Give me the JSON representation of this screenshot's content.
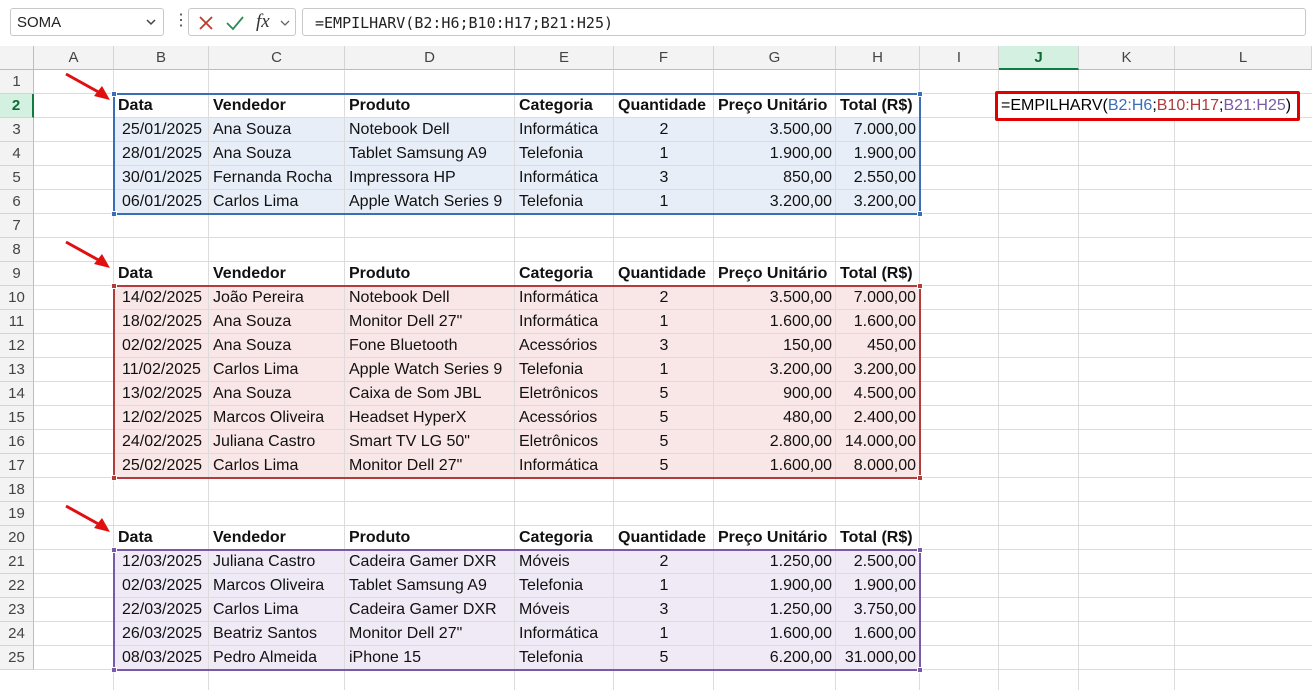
{
  "name_box": "SOMA",
  "formula_bar": {
    "fx": "fx",
    "formula": "=EMPILHARV(B2:H6;B10:H17;B21:H25)"
  },
  "columns": [
    "A",
    "B",
    "C",
    "D",
    "E",
    "F",
    "G",
    "H",
    "I",
    "J",
    "K",
    "L"
  ],
  "rows": [
    "1",
    "2",
    "3",
    "4",
    "5",
    "6",
    "7",
    "8",
    "9",
    "10",
    "11",
    "12",
    "13",
    "14",
    "15",
    "16",
    "17",
    "18",
    "19",
    "20",
    "21",
    "22",
    "23",
    "24",
    "25"
  ],
  "selected_column": "J",
  "selected_row": "2",
  "headers": [
    "Data",
    "Vendedor",
    "Produto",
    "Categoria",
    "Quantidade",
    "Preço Unitário",
    "Total (R$)"
  ],
  "tables": [
    {
      "color": "#3a6fb5",
      "fill": "#e8eef8",
      "header_row": 2,
      "rows": [
        [
          "25/01/2025",
          "Ana Souza",
          "Notebook Dell",
          "Informática",
          "2",
          "3.500,00",
          "7.000,00"
        ],
        [
          "28/01/2025",
          "Ana Souza",
          "Tablet Samsung A9",
          "Telefonia",
          "1",
          "1.900,00",
          "1.900,00"
        ],
        [
          "30/01/2025",
          "Fernanda Rocha",
          "Impressora HP",
          "Informática",
          "3",
          "850,00",
          "2.550,00"
        ],
        [
          "06/01/2025",
          "Carlos Lima",
          "Apple Watch Series 9",
          "Telefonia",
          "1",
          "3.200,00",
          "3.200,00"
        ]
      ]
    },
    {
      "color": "#b23b3b",
      "fill": "#f9e6e6",
      "header_row": 9,
      "rows": [
        [
          "14/02/2025",
          "João Pereira",
          "Notebook Dell",
          "Informática",
          "2",
          "3.500,00",
          "7.000,00"
        ],
        [
          "18/02/2025",
          "Ana Souza",
          "Monitor Dell 27\"",
          "Informática",
          "1",
          "1.600,00",
          "1.600,00"
        ],
        [
          "02/02/2025",
          "Ana Souza",
          "Fone Bluetooth",
          "Acessórios",
          "3",
          "150,00",
          "450,00"
        ],
        [
          "11/02/2025",
          "Carlos Lima",
          "Apple Watch Series 9",
          "Telefonia",
          "1",
          "3.200,00",
          "3.200,00"
        ],
        [
          "13/02/2025",
          "Ana Souza",
          "Caixa de Som JBL",
          "Eletrônicos",
          "5",
          "900,00",
          "4.500,00"
        ],
        [
          "12/02/2025",
          "Marcos Oliveira",
          "Headset HyperX",
          "Acessórios",
          "5",
          "480,00",
          "2.400,00"
        ],
        [
          "24/02/2025",
          "Juliana Castro",
          "Smart TV LG 50\"",
          "Eletrônicos",
          "5",
          "2.800,00",
          "14.000,00"
        ],
        [
          "25/02/2025",
          "Carlos Lima",
          "Monitor Dell 27\"",
          "Informática",
          "5",
          "1.600,00",
          "8.000,00"
        ]
      ]
    },
    {
      "color": "#7a5aa8",
      "fill": "#efeaf6",
      "header_row": 20,
      "rows": [
        [
          "12/03/2025",
          "Juliana Castro",
          "Cadeira Gamer DXR",
          "Móveis",
          "2",
          "1.250,00",
          "2.500,00"
        ],
        [
          "02/03/2025",
          "Marcos Oliveira",
          "Tablet Samsung A9",
          "Telefonia",
          "1",
          "1.900,00",
          "1.900,00"
        ],
        [
          "22/03/2025",
          "Carlos Lima",
          "Cadeira Gamer DXR",
          "Móveis",
          "3",
          "1.250,00",
          "3.750,00"
        ],
        [
          "26/03/2025",
          "Beatriz Santos",
          "Monitor Dell 27\"",
          "Informática",
          "1",
          "1.600,00",
          "1.600,00"
        ],
        [
          "08/03/2025",
          "Pedro Almeida",
          "iPhone 15",
          "Telefonia",
          "5",
          "6.200,00",
          "31.000,00"
        ]
      ]
    }
  ],
  "formula_cell": {
    "prefix": "=EMPILHARV(",
    "ref1": "B2:H6",
    "sep1": ";",
    "ref2": "B10:H17",
    "sep2": ";",
    "ref3": "B21:H25",
    "suffix": ")"
  },
  "accent_color": "#107c41",
  "arrow_color": "#e01010",
  "highlight_color": "#e00000"
}
